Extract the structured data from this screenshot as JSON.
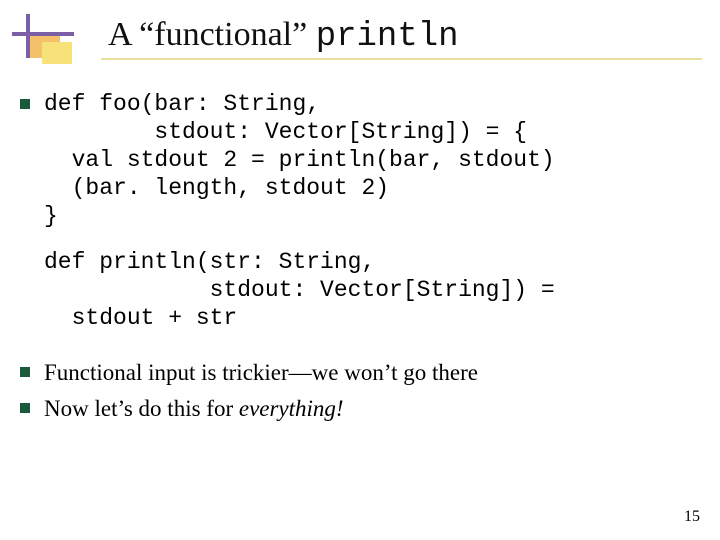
{
  "title_prefix": "A “functional” ",
  "title_mono": "println",
  "code1": "def foo(bar: String,\n        stdout: Vector[String]) = {\n  val stdout 2 = println(bar, stdout)\n  (bar. length, stdout 2)\n}",
  "code2": "def println(str: String,\n            stdout: Vector[String]) =\n  stdout + str",
  "bullet2": "Functional input is trickier—we won’t go there",
  "bullet3_prefix": "Now let’s do this for ",
  "bullet3_em": "everything!",
  "page_number": "15"
}
